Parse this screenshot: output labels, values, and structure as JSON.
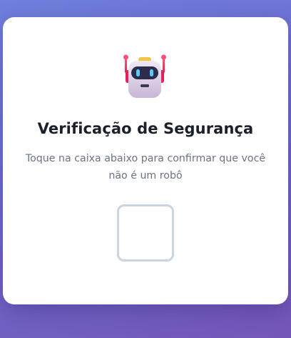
{
  "dialog": {
    "title": "Verificação de Segurança",
    "subtitle": "Toque na caixa abaixo para confirmar que você não é um robô",
    "icon": "robot-icon",
    "checkbox_checked": false
  },
  "colors": {
    "background_start": "#6f7fdc",
    "background_end": "#7456b8",
    "card": "#ffffff",
    "title": "#1b1f2a",
    "subtitle": "#6b7385",
    "checkbox_border": "#cbd5e0"
  }
}
